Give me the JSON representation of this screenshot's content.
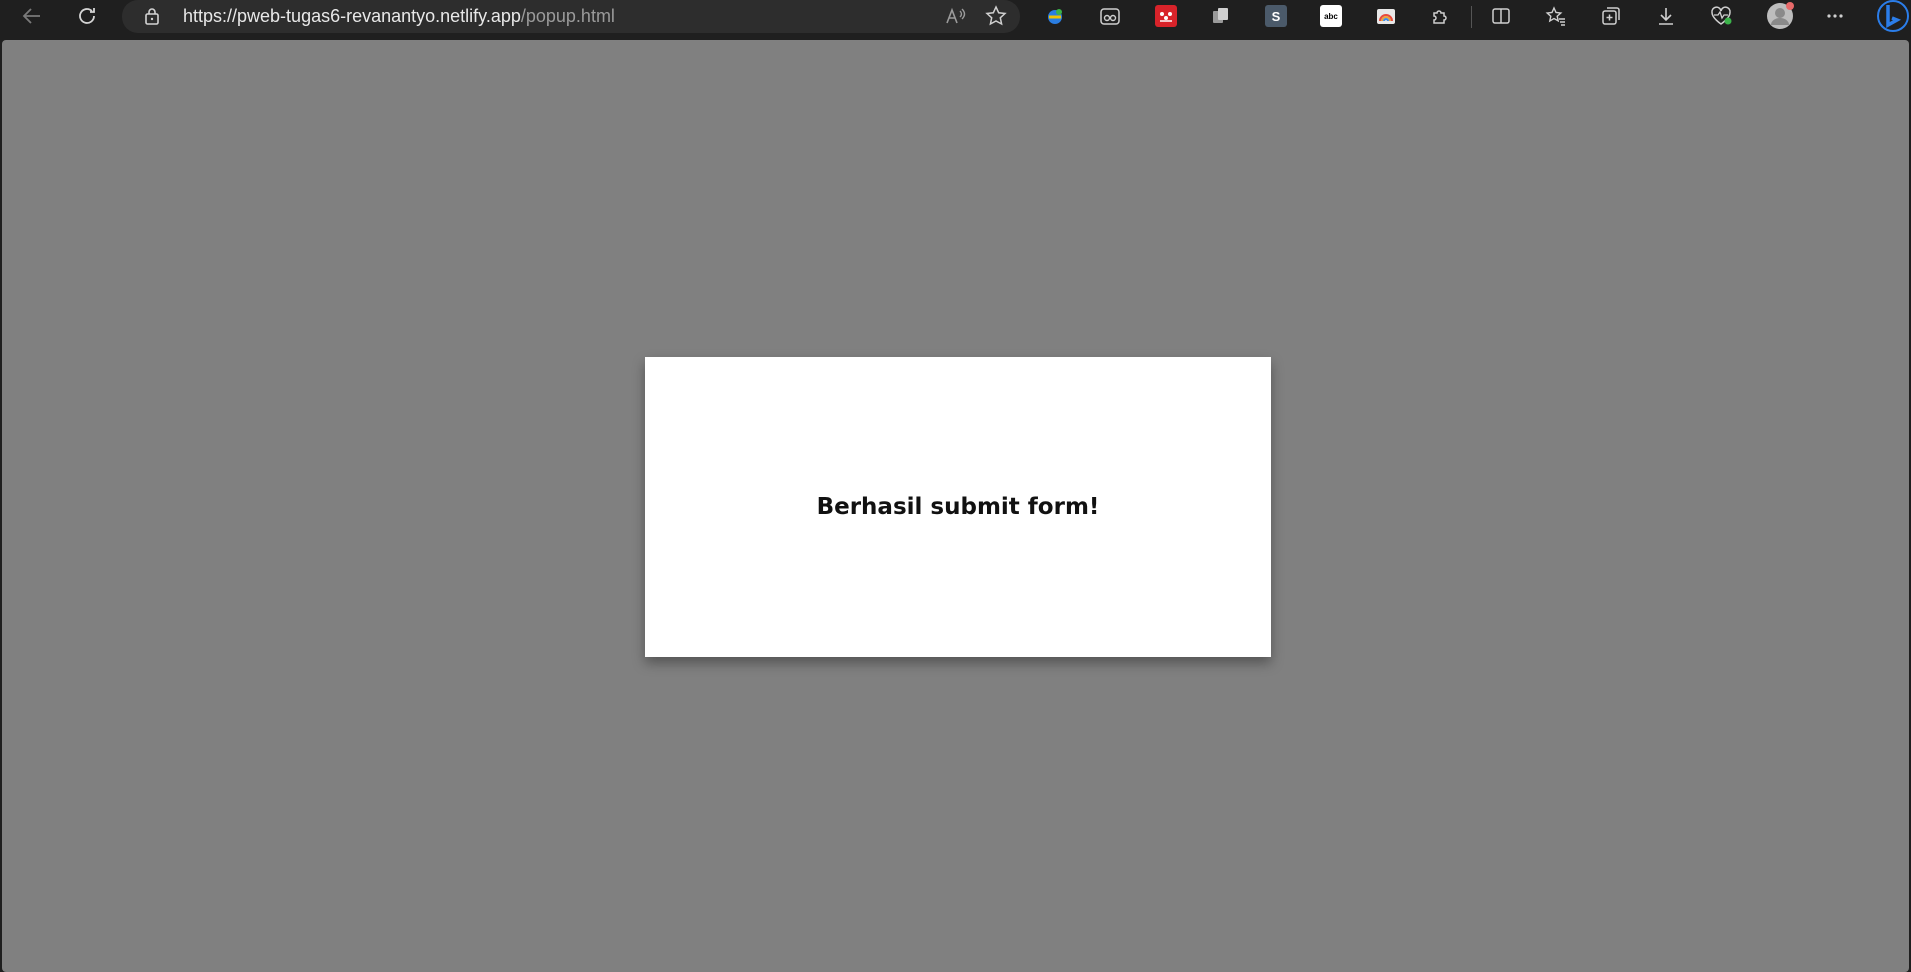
{
  "browser": {
    "url_main": "https://pweb-tugas6-revanantyo.netlify.app",
    "url_path": "/popup.html",
    "toolbar_icons": [
      "back-arrow-icon",
      "refresh-icon",
      "lock-icon",
      "read-aloud-icon",
      "favorite-star-icon"
    ],
    "extensions": [
      {
        "name": "ie-globe-extension-icon",
        "color": "#2a7de1"
      },
      {
        "name": "reader-glasses-extension-icon",
        "color": "#cfcfcf"
      },
      {
        "name": "mendeley-extension-icon",
        "color": "#d8232a"
      },
      {
        "name": "copy-extension-icon",
        "color": "#cfcfcf"
      },
      {
        "name": "s-extension-icon",
        "color": "#4b5a6a",
        "label": "S"
      },
      {
        "name": "abc-extension-icon",
        "color": "#ffffff",
        "label": "abc"
      },
      {
        "name": "rainbow-extension-icon",
        "color": "#e8a33d"
      }
    ]
  },
  "popup": {
    "message": "Berhasil submit form!"
  },
  "colors": {
    "page_overlay": "#808080",
    "popup_bg": "#ffffff",
    "browser_chrome": "#1f1f1f"
  }
}
